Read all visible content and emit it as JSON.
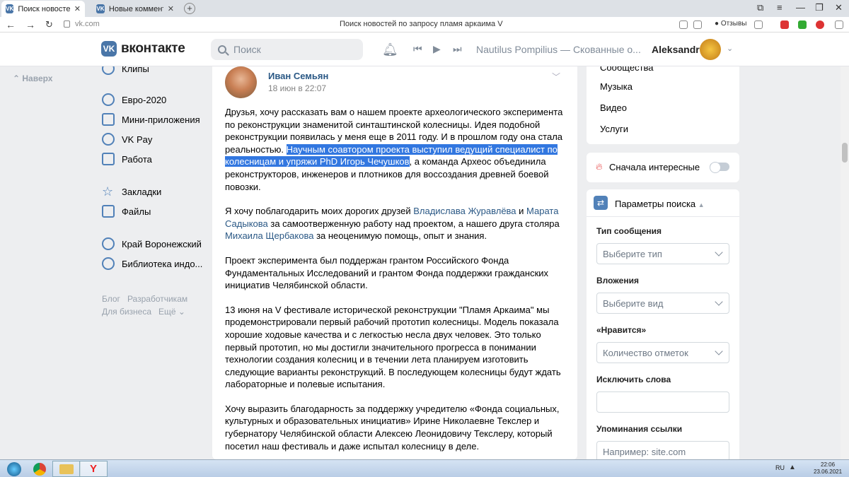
{
  "browser": {
    "tabs": [
      {
        "title": "Поиск новостей по зап",
        "active": true
      },
      {
        "title": "Новые комментарии",
        "active": false
      }
    ],
    "url": "vk.com",
    "page_title": "Поиск новостей по запросу пламя аркаима V",
    "reviews_label": "Отзывы"
  },
  "header": {
    "logo_text": "вконтакте",
    "search_placeholder": "Поиск",
    "now_playing": "Nautilus Pompilius — Скованные о...",
    "user_name": "Aleksandr"
  },
  "sidebar": {
    "up_label": "Наверх",
    "items": [
      {
        "label": "Клипы",
        "icon": "clips-icon"
      },
      {
        "label": "Евро-2020",
        "icon": "football-icon"
      },
      {
        "label": "Мини-приложения",
        "icon": "apps-icon"
      },
      {
        "label": "VK Pay",
        "icon": "vkpay-icon"
      },
      {
        "label": "Работа",
        "icon": "briefcase-icon"
      },
      {
        "label": "Закладки",
        "icon": "star-icon"
      },
      {
        "label": "Файлы",
        "icon": "file-icon"
      },
      {
        "label": "Край Воронежский",
        "icon": "group-icon"
      },
      {
        "label": "Библиотека индо...",
        "icon": "group-icon"
      }
    ],
    "footer": [
      "Блог",
      "Разработчикам",
      "Для бизнеса",
      "Ещё"
    ]
  },
  "post": {
    "author": "Иван Семьян",
    "date": "18 июн в 22:07",
    "p1_a": "Друзья, хочу рассказать вам о нашем проекте археологического эксперимента по реконструкции знаменитой синташтинской колесницы. Идея подобной реконструкции появилась у меня еще в 2011 году. И в прошлом году она стала реальностью. ",
    "p1_hl": "Научным соавтором проекта выступил ведущий специалист по колесницам и упряжи PhD Игорь Чечушков",
    "p1_b": ", а команда Археос объединила реконструкторов, инженеров и плотников для воссоздания древней боевой повозки.",
    "p2_a": "Я хочу поблагодарить моих дорогих друзей ",
    "p2_link1": "Владислава Журавлёва",
    "p2_b": " и ",
    "p2_link2": "Марата Садыкова",
    "p2_c": " за самоотверженную работу над проектом, а нашего друга столяра ",
    "p2_link3": "Михаила Щербакова",
    "p2_d": " за неоценимую помощь, опыт и знания.",
    "p3": "Проект эксперимента был поддержан грантом Российского Фонда Фундаментальных Исследований и грантом Фонда поддержки гражданских инициатив Челябинской области.",
    "p4": "13 июня на V фестивале исторической реконструкции \"Пламя Аркаима\" мы продемонстрировали первый рабочий прототип колесницы. Модель показала хорошие ходовые качества и с легкостью несла двух человек. Это только первый прототип, но мы достигли значительного прогресса в понимании технологии создания колесниц и в течении лета планируем изготовить следующие варианты реконструкций. В последующем колесницы будут ждать лабораторные и полевые испытания.",
    "p5": "Хочу выразить благодарность за поддержку учредителю «Фонда социальных, культурных и образовательных инициатив» Ирине Николаевне Текслер и губернатору Челябинской области Алексею Леонидовичу Текслеру, который посетил наш фестиваль и даже испытал колесницу в деле."
  },
  "right": {
    "links": [
      "Сообщества",
      "Музыка",
      "Видео",
      "Услуги"
    ],
    "interesting_label": "Сначала интересные",
    "params_title": "Параметры поиска",
    "msg_type_label": "Тип сообщения",
    "msg_type_value": "Выберите тип",
    "attach_label": "Вложения",
    "attach_value": "Выберите вид",
    "likes_label": "«Нравится»",
    "likes_value": "Количество отметок",
    "exclude_label": "Исключить слова",
    "mention_label": "Упоминания ссылки",
    "mention_placeholder": "Например: site.com"
  },
  "taskbar": {
    "lang": "RU",
    "time": "22:06",
    "date": "23.06.2021"
  },
  "colors": {
    "vk_blue": "#4a76a8",
    "link": "#2a5885",
    "highlight": "#3277e0"
  }
}
